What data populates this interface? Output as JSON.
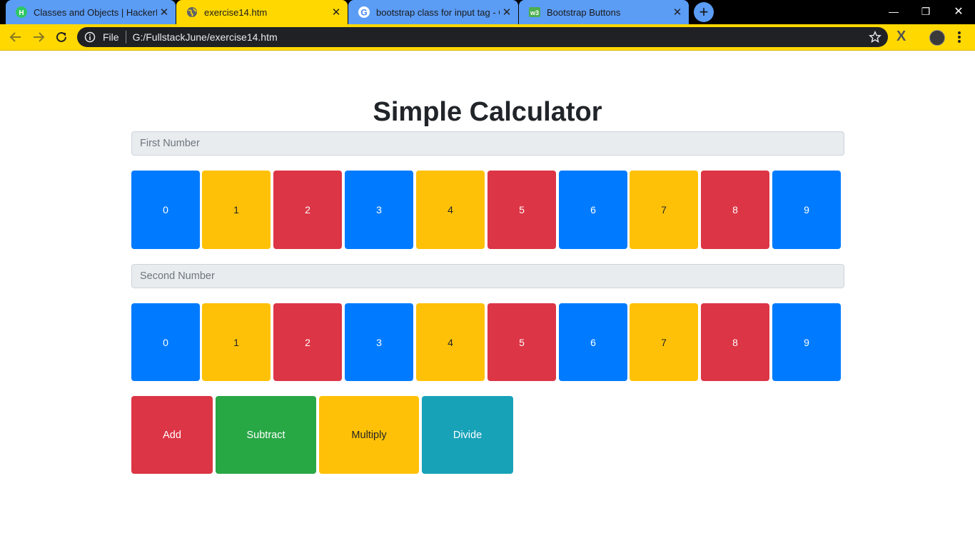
{
  "browser": {
    "tabs": [
      {
        "title": "Classes and Objects | HackerRank",
        "favicon": "hackerrank-icon",
        "bg": "#5b9cf5"
      },
      {
        "title": "exercise14.htm",
        "favicon": "globe-icon",
        "bg": "#ffd800"
      },
      {
        "title": "bootstrap class for input tag - Google Search",
        "favicon": "google-icon",
        "bg": "#5b9cf5"
      },
      {
        "title": "Bootstrap Buttons",
        "favicon": "w3schools-icon",
        "bg": "#5b9cf5"
      }
    ],
    "address": {
      "scheme": "File",
      "url": "G:/FullstackJune/exercise14.htm"
    }
  },
  "page": {
    "title": "Simple Calculator",
    "first_placeholder": "First Number",
    "second_placeholder": "Second Number",
    "digits": [
      "0",
      "1",
      "2",
      "3",
      "4",
      "5",
      "6",
      "7",
      "8",
      "9"
    ],
    "digit_colors": [
      "blue",
      "yellow",
      "red",
      "blue",
      "yellow",
      "red",
      "blue",
      "yellow",
      "red",
      "blue"
    ],
    "operations": [
      {
        "label": "Add",
        "color": "#dc3545",
        "text_color": "#ffffff"
      },
      {
        "label": "Subtract",
        "color": "#28a745",
        "text_color": "#ffffff"
      },
      {
        "label": "Multiply",
        "color": "#ffc107",
        "text_color": "#212529"
      },
      {
        "label": "Divide",
        "color": "#17a2b8",
        "text_color": "#ffffff"
      }
    ]
  },
  "colors": {
    "blue": "#007bff",
    "yellow": "#ffc107",
    "red": "#dc3545",
    "success": "#28a745",
    "info": "#17a2b8",
    "chrome_yellow": "#ffd800"
  }
}
